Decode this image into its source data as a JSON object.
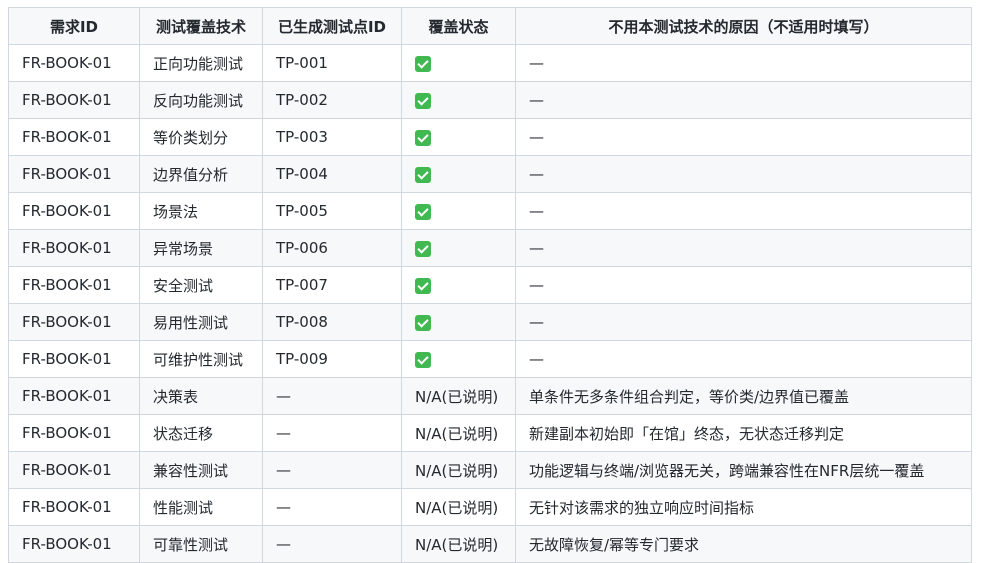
{
  "headers": [
    "需求ID",
    "测试覆盖技术",
    "已生成测试点ID",
    "覆盖状态",
    "不用本测试技术的原因（不适用时填写）"
  ],
  "rows": [
    {
      "req_id": "FR-BOOK-01",
      "technique": "正向功能测试",
      "tp_id": "TP-001",
      "status": "covered",
      "status_text": "",
      "reason": "—"
    },
    {
      "req_id": "FR-BOOK-01",
      "technique": "反向功能测试",
      "tp_id": "TP-002",
      "status": "covered",
      "status_text": "",
      "reason": "—"
    },
    {
      "req_id": "FR-BOOK-01",
      "technique": "等价类划分",
      "tp_id": "TP-003",
      "status": "covered",
      "status_text": "",
      "reason": "—"
    },
    {
      "req_id": "FR-BOOK-01",
      "technique": "边界值分析",
      "tp_id": "TP-004",
      "status": "covered",
      "status_text": "",
      "reason": "—"
    },
    {
      "req_id": "FR-BOOK-01",
      "technique": "场景法",
      "tp_id": "TP-005",
      "status": "covered",
      "status_text": "",
      "reason": "—"
    },
    {
      "req_id": "FR-BOOK-01",
      "technique": "异常场景",
      "tp_id": "TP-006",
      "status": "covered",
      "status_text": "",
      "reason": "—"
    },
    {
      "req_id": "FR-BOOK-01",
      "technique": "安全测试",
      "tp_id": "TP-007",
      "status": "covered",
      "status_text": "",
      "reason": "—"
    },
    {
      "req_id": "FR-BOOK-01",
      "technique": "易用性测试",
      "tp_id": "TP-008",
      "status": "covered",
      "status_text": "",
      "reason": "—"
    },
    {
      "req_id": "FR-BOOK-01",
      "technique": "可维护性测试",
      "tp_id": "TP-009",
      "status": "covered",
      "status_text": "",
      "reason": "—"
    },
    {
      "req_id": "FR-BOOK-01",
      "technique": "决策表",
      "tp_id": "—",
      "status": "na",
      "status_text": "N/A(已说明)",
      "reason": "单条件无多条件组合判定，等价类/边界值已覆盖"
    },
    {
      "req_id": "FR-BOOK-01",
      "technique": "状态迁移",
      "tp_id": "—",
      "status": "na",
      "status_text": "N/A(已说明)",
      "reason": "新建副本初始即「在馆」终态，无状态迁移判定"
    },
    {
      "req_id": "FR-BOOK-01",
      "technique": "兼容性测试",
      "tp_id": "—",
      "status": "na",
      "status_text": "N/A(已说明)",
      "reason": "功能逻辑与终端/浏览器无关，跨端兼容性在NFR层统一覆盖"
    },
    {
      "req_id": "FR-BOOK-01",
      "technique": "性能测试",
      "tp_id": "—",
      "status": "na",
      "status_text": "N/A(已说明)",
      "reason": "无针对该需求的独立响应时间指标"
    },
    {
      "req_id": "FR-BOOK-01",
      "technique": "可靠性测试",
      "tp_id": "—",
      "status": "na",
      "status_text": "N/A(已说明)",
      "reason": "无故障恢复/幂等专门要求"
    }
  ],
  "icons": {
    "covered": "check-mark-button-icon"
  },
  "colors": {
    "check": "#3fb950",
    "header_bg": "#f6f8fa",
    "border": "#d0d7de"
  }
}
